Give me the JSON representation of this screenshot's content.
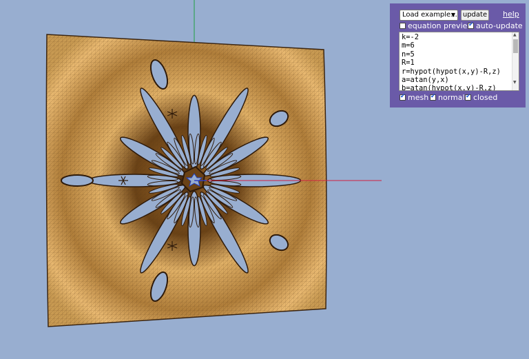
{
  "controls": {
    "load_example": "Load example...",
    "update_label": "update",
    "help_label": "help",
    "equation_preview": {
      "label": "equation preview",
      "checked": false
    },
    "auto_update": {
      "label": "auto-update",
      "checked": true
    },
    "mesh": {
      "label": "mesh",
      "checked": true
    },
    "normal": {
      "label": "normal",
      "checked": true
    },
    "closed": {
      "label": "closed",
      "checked": true
    }
  },
  "editor": {
    "code": "k=-2\nm=6\nn=5\nR=1\nr=hypot(hypot(x,y)-R,z)\na=atan(y,x)\nb=atan(hypot(x,y)-R,z)"
  },
  "colors": {
    "background": "#98aed0",
    "panel": "#6a5aa8",
    "surface_light": "#e8b870",
    "surface_dark": "#2e1a0a",
    "axis_x": "#d02040",
    "axis_y": "#20a040",
    "axis_z": "#3040c0"
  },
  "icons": [
    "chevron-down-icon",
    "checkmark-icon",
    "scroll-up-icon",
    "scroll-down-icon"
  ]
}
